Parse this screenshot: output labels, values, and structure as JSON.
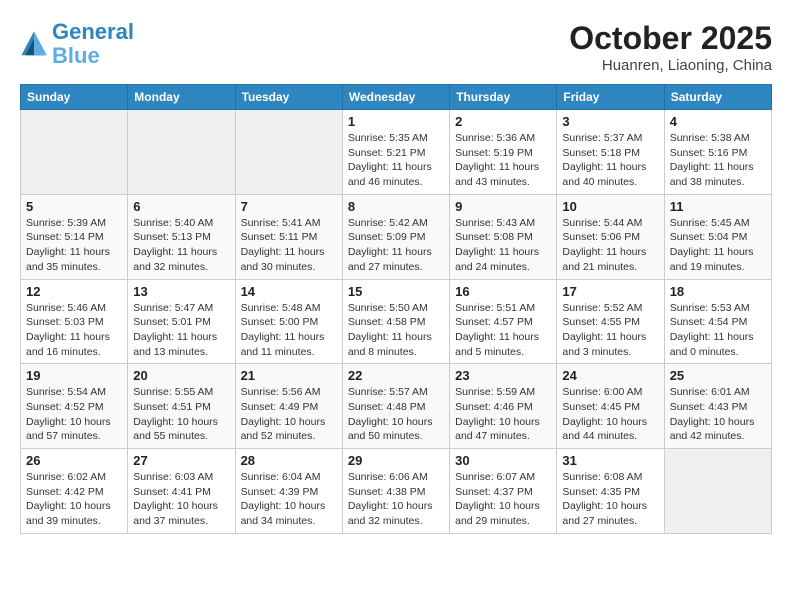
{
  "header": {
    "logo_line1": "General",
    "logo_line2": "Blue",
    "title": "October 2025",
    "subtitle": "Huanren, Liaoning, China"
  },
  "days_of_week": [
    "Sunday",
    "Monday",
    "Tuesday",
    "Wednesday",
    "Thursday",
    "Friday",
    "Saturday"
  ],
  "weeks": [
    [
      {
        "day": "",
        "info": ""
      },
      {
        "day": "",
        "info": ""
      },
      {
        "day": "",
        "info": ""
      },
      {
        "day": "1",
        "info": "Sunrise: 5:35 AM\nSunset: 5:21 PM\nDaylight: 11 hours and 46 minutes."
      },
      {
        "day": "2",
        "info": "Sunrise: 5:36 AM\nSunset: 5:19 PM\nDaylight: 11 hours and 43 minutes."
      },
      {
        "day": "3",
        "info": "Sunrise: 5:37 AM\nSunset: 5:18 PM\nDaylight: 11 hours and 40 minutes."
      },
      {
        "day": "4",
        "info": "Sunrise: 5:38 AM\nSunset: 5:16 PM\nDaylight: 11 hours and 38 minutes."
      }
    ],
    [
      {
        "day": "5",
        "info": "Sunrise: 5:39 AM\nSunset: 5:14 PM\nDaylight: 11 hours and 35 minutes."
      },
      {
        "day": "6",
        "info": "Sunrise: 5:40 AM\nSunset: 5:13 PM\nDaylight: 11 hours and 32 minutes."
      },
      {
        "day": "7",
        "info": "Sunrise: 5:41 AM\nSunset: 5:11 PM\nDaylight: 11 hours and 30 minutes."
      },
      {
        "day": "8",
        "info": "Sunrise: 5:42 AM\nSunset: 5:09 PM\nDaylight: 11 hours and 27 minutes."
      },
      {
        "day": "9",
        "info": "Sunrise: 5:43 AM\nSunset: 5:08 PM\nDaylight: 11 hours and 24 minutes."
      },
      {
        "day": "10",
        "info": "Sunrise: 5:44 AM\nSunset: 5:06 PM\nDaylight: 11 hours and 21 minutes."
      },
      {
        "day": "11",
        "info": "Sunrise: 5:45 AM\nSunset: 5:04 PM\nDaylight: 11 hours and 19 minutes."
      }
    ],
    [
      {
        "day": "12",
        "info": "Sunrise: 5:46 AM\nSunset: 5:03 PM\nDaylight: 11 hours and 16 minutes."
      },
      {
        "day": "13",
        "info": "Sunrise: 5:47 AM\nSunset: 5:01 PM\nDaylight: 11 hours and 13 minutes."
      },
      {
        "day": "14",
        "info": "Sunrise: 5:48 AM\nSunset: 5:00 PM\nDaylight: 11 hours and 11 minutes."
      },
      {
        "day": "15",
        "info": "Sunrise: 5:50 AM\nSunset: 4:58 PM\nDaylight: 11 hours and 8 minutes."
      },
      {
        "day": "16",
        "info": "Sunrise: 5:51 AM\nSunset: 4:57 PM\nDaylight: 11 hours and 5 minutes."
      },
      {
        "day": "17",
        "info": "Sunrise: 5:52 AM\nSunset: 4:55 PM\nDaylight: 11 hours and 3 minutes."
      },
      {
        "day": "18",
        "info": "Sunrise: 5:53 AM\nSunset: 4:54 PM\nDaylight: 11 hours and 0 minutes."
      }
    ],
    [
      {
        "day": "19",
        "info": "Sunrise: 5:54 AM\nSunset: 4:52 PM\nDaylight: 10 hours and 57 minutes."
      },
      {
        "day": "20",
        "info": "Sunrise: 5:55 AM\nSunset: 4:51 PM\nDaylight: 10 hours and 55 minutes."
      },
      {
        "day": "21",
        "info": "Sunrise: 5:56 AM\nSunset: 4:49 PM\nDaylight: 10 hours and 52 minutes."
      },
      {
        "day": "22",
        "info": "Sunrise: 5:57 AM\nSunset: 4:48 PM\nDaylight: 10 hours and 50 minutes."
      },
      {
        "day": "23",
        "info": "Sunrise: 5:59 AM\nSunset: 4:46 PM\nDaylight: 10 hours and 47 minutes."
      },
      {
        "day": "24",
        "info": "Sunrise: 6:00 AM\nSunset: 4:45 PM\nDaylight: 10 hours and 44 minutes."
      },
      {
        "day": "25",
        "info": "Sunrise: 6:01 AM\nSunset: 4:43 PM\nDaylight: 10 hours and 42 minutes."
      }
    ],
    [
      {
        "day": "26",
        "info": "Sunrise: 6:02 AM\nSunset: 4:42 PM\nDaylight: 10 hours and 39 minutes."
      },
      {
        "day": "27",
        "info": "Sunrise: 6:03 AM\nSunset: 4:41 PM\nDaylight: 10 hours and 37 minutes."
      },
      {
        "day": "28",
        "info": "Sunrise: 6:04 AM\nSunset: 4:39 PM\nDaylight: 10 hours and 34 minutes."
      },
      {
        "day": "29",
        "info": "Sunrise: 6:06 AM\nSunset: 4:38 PM\nDaylight: 10 hours and 32 minutes."
      },
      {
        "day": "30",
        "info": "Sunrise: 6:07 AM\nSunset: 4:37 PM\nDaylight: 10 hours and 29 minutes."
      },
      {
        "day": "31",
        "info": "Sunrise: 6:08 AM\nSunset: 4:35 PM\nDaylight: 10 hours and 27 minutes."
      },
      {
        "day": "",
        "info": ""
      }
    ]
  ]
}
